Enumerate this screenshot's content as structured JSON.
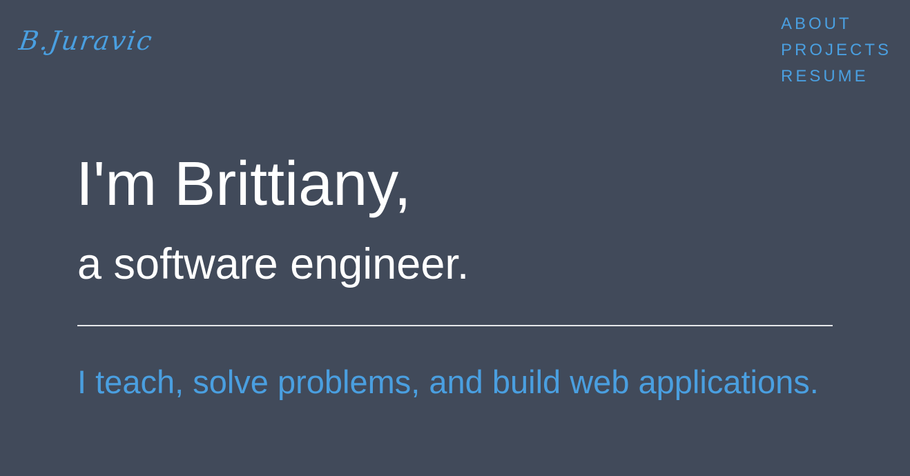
{
  "logo": {
    "text": "B.Juravic"
  },
  "nav": {
    "items": [
      {
        "label": "ABOUT"
      },
      {
        "label": "PROJECTS"
      },
      {
        "label": "RESUME"
      }
    ]
  },
  "hero": {
    "headline": "I'm Brittiany,",
    "subheadline": "a software engineer.",
    "tagline": "I teach, solve problems, and build web applications."
  },
  "colors": {
    "background": "#414a5a",
    "accent": "#4a9fe0",
    "text": "#ffffff",
    "divider": "#e6e8eb"
  }
}
